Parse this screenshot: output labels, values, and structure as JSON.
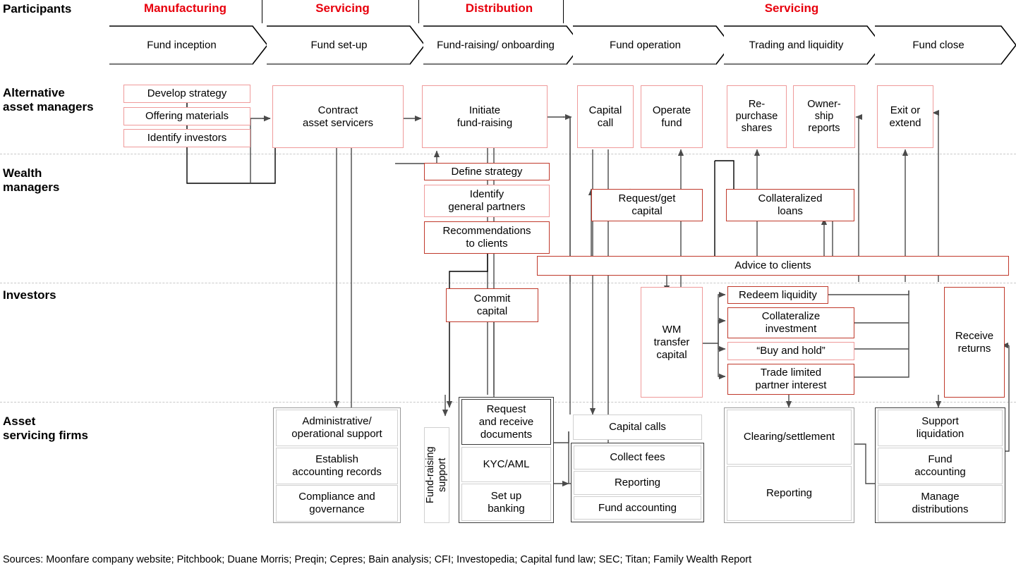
{
  "header": {
    "participants_label": "Participants",
    "groups": [
      {
        "label": "Manufacturing"
      },
      {
        "label": "Servicing"
      },
      {
        "label": "Distribution"
      },
      {
        "label": "Servicing"
      }
    ],
    "phases": [
      {
        "label": "Fund\ninception"
      },
      {
        "label": "Fund\nset-up"
      },
      {
        "label": "Fund-raising/\nonboarding"
      },
      {
        "label": "Fund\noperation"
      },
      {
        "label": "Trading and\nliquidity"
      },
      {
        "label": "Fund\nclose"
      }
    ]
  },
  "rows": [
    {
      "label": "Alternative\nasset managers"
    },
    {
      "label": "Wealth\nmanagers"
    },
    {
      "label": "Investors"
    },
    {
      "label": "Asset\nservicing firms"
    }
  ],
  "boxes": {
    "develop_strategy": "Develop strategy",
    "offering_materials": "Offering materials",
    "identify_investors": "Identify investors",
    "contract_asset_servicers": "Contract\nasset servicers",
    "initiate_fundraising": "Initiate\nfund-raising",
    "capital_call": "Capital\ncall",
    "operate_fund": "Operate\nfund",
    "repurchase_shares": "Re-\npurchase\nshares",
    "ownership_reports": "Owner-\nship\nreports",
    "exit_or_extend": "Exit or\nextend",
    "define_strategy": "Define strategy",
    "identify_general_partners": "Identify\ngeneral partners",
    "recommendations_to_clients": "Recommendations\nto clients",
    "request_get_capital": "Request/get\ncapital",
    "collateralized_loans": "Collateralized\nloans",
    "advice_to_clients": "Advice to clients",
    "commit_capital": "Commit\ncapital",
    "wm_transfer_capital": "WM\ntransfer\ncapital",
    "redeem_liquidity": "Redeem liquidity",
    "collateralize_investment": "Collateralize\ninvestment",
    "buy_and_hold": "“Buy and hold”",
    "trade_limited_partner_interest": "Trade limited\npartner interest",
    "receive_returns": "Receive\nreturns",
    "administrative_operational_support": "Administrative/\noperational support",
    "establish_accounting_records": "Establish\naccounting records",
    "compliance_and_governance": "Compliance and\ngovernance",
    "fundraising_support": "Fund-raising\nsupport",
    "request_and_receive_documents": "Request\nand receive\ndocuments",
    "kyc_aml": "KYC/AML",
    "set_up_banking": "Set up\nbanking",
    "capital_calls": "Capital calls",
    "collect_fees": "Collect fees",
    "reporting_ops": "Reporting",
    "fund_accounting_ops": "Fund accounting",
    "clearing_settlement": "Clearing/settlement",
    "reporting_trading": "Reporting",
    "support_liquidation": "Support\nliquidation",
    "fund_accounting_close": "Fund\naccounting",
    "manage_distributions": "Manage\ndistributions"
  },
  "footer": {
    "sources": "Sources: Moonfare company website; Pitchbook; Duane Morris; Preqin; Cepres; Bain analysis; CFI; Investopedia; Capital fund law; SEC; Titan; Family Wealth Report"
  },
  "colors": {
    "group_header_red": "#e8000d",
    "box_border_light_red": "#ef9a9a",
    "box_border_dark_red": "#c0392b",
    "box_border_gray": "#d0d0d0",
    "band_divider": "#c9c9c9",
    "wire": "#4a4a4a"
  }
}
